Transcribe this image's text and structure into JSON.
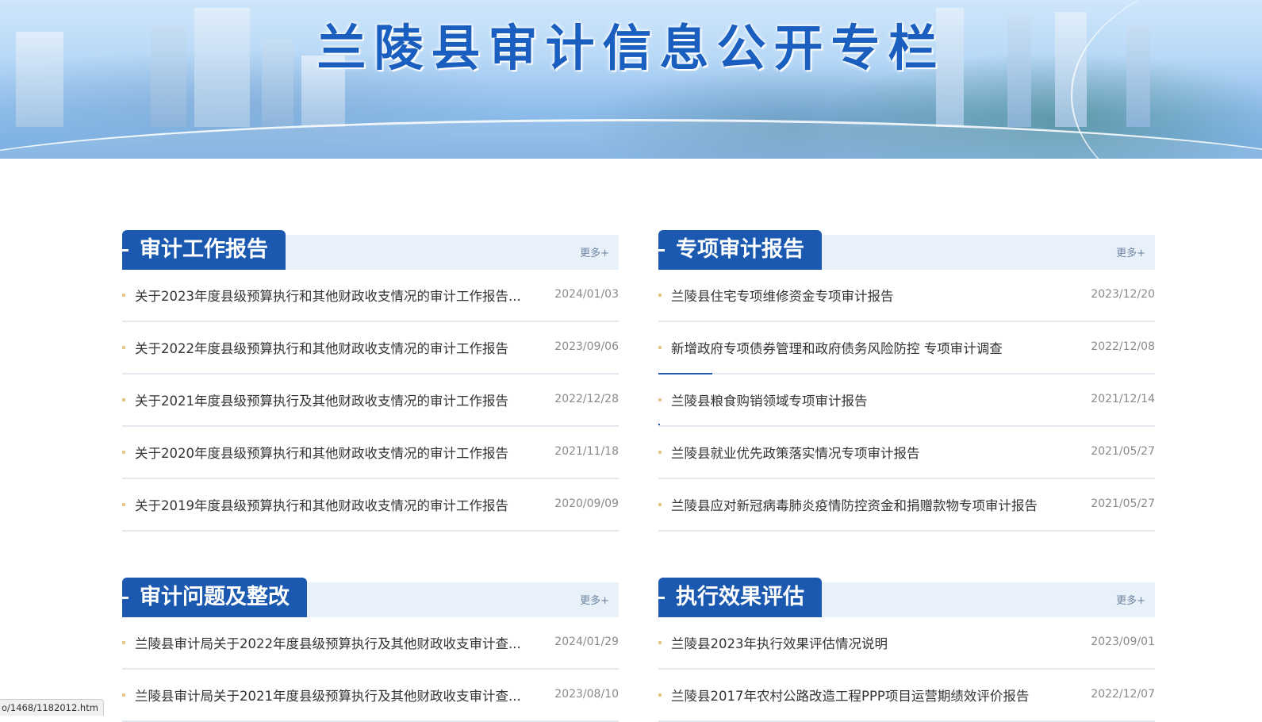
{
  "banner": {
    "title": "兰陵县审计信息公开专栏"
  },
  "panels": [
    {
      "title": "审计工作报告",
      "more": "更多+",
      "items": [
        {
          "title": "关于2023年度县级预算执行和其他财政收支情况的审计工作报告...",
          "date": "2024/01/03"
        },
        {
          "title": "关于2022年度县级预算执行和其他财政收支情况的审计工作报告",
          "date": "2023/09/06"
        },
        {
          "title": "关于2021年度县级预算执行及其他财政收支情况的审计工作报告",
          "date": "2022/12/28"
        },
        {
          "title": "关于2020年度县级预算执行和其他财政收支情况的审计工作报告",
          "date": "2021/11/18"
        },
        {
          "title": "关于2019年度县级预算执行和其他财政收支情况的审计工作报告",
          "date": "2020/09/09"
        }
      ]
    },
    {
      "title": "专项审计报告",
      "more": "更多+",
      "items": [
        {
          "title": "兰陵县住宅专项维修资金专项审计报告",
          "date": "2023/12/20"
        },
        {
          "title": "新增政府专项债券管理和政府债务风险防控 专项审计调查",
          "date": "2022/12/08"
        },
        {
          "title": "兰陵县粮食购销领域专项审计报告",
          "date": "2021/12/14"
        },
        {
          "title": "兰陵县就业优先政策落实情况专项审计报告",
          "date": "2021/05/27"
        },
        {
          "title": "兰陵县应对新冠病毒肺炎疫情防控资金和捐赠款物专项审计报告",
          "date": "2021/05/27"
        }
      ]
    },
    {
      "title": "审计问题及整改",
      "more": "更多+",
      "items": [
        {
          "title": "兰陵县审计局关于2022年度县级预算执行及其他财政收支审计查...",
          "date": "2024/01/29"
        },
        {
          "title": "兰陵县审计局关于2021年度县级预算执行及其他财政收支审计查...",
          "date": "2023/08/10"
        }
      ]
    },
    {
      "title": "执行效果评估",
      "more": "更多+",
      "items": [
        {
          "title": "兰陵县2023年执行效果评估情况说明",
          "date": "2023/09/01"
        },
        {
          "title": "兰陵县2017年农村公路改造工程PPP项目运营期绩效评价报告",
          "date": "2022/12/07"
        }
      ]
    }
  ],
  "statusbar": {
    "url": "o/1468/1182012.htm"
  }
}
